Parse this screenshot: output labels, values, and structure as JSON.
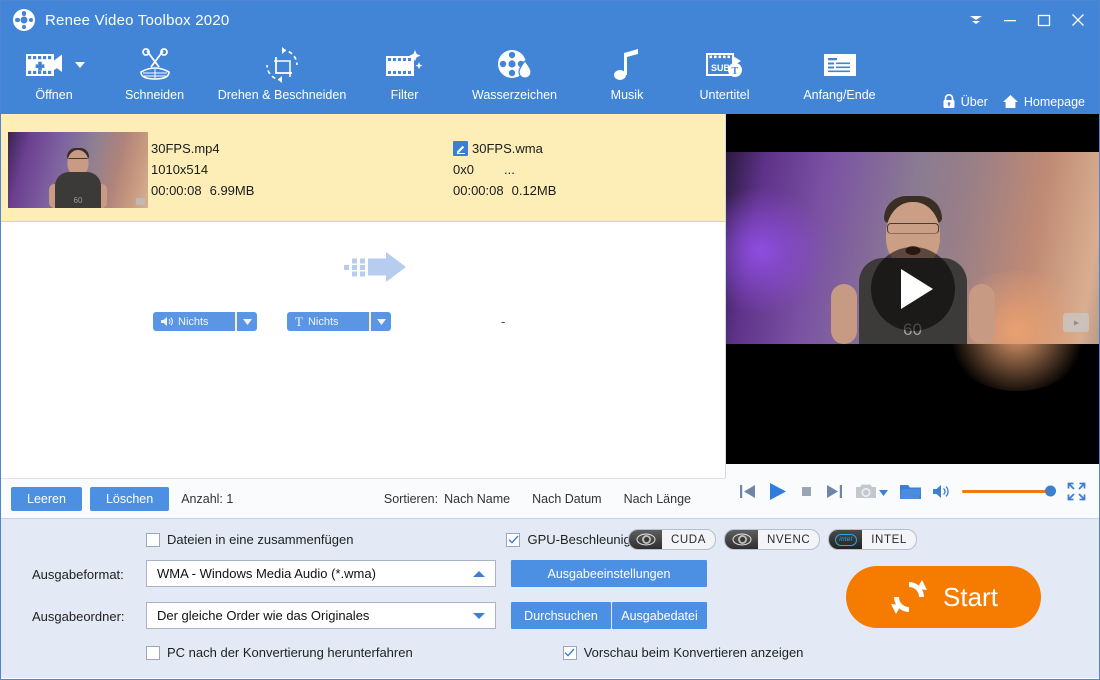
{
  "window": {
    "title": "Renee Video Toolbox 2020",
    "logo_icon": "film-reel-icon",
    "controls": [
      {
        "name": "collapse-ribbon-button",
        "icon": "chevron-double-down-icon"
      },
      {
        "name": "minimize-button",
        "icon": "minimize-icon"
      },
      {
        "name": "maximize-button",
        "icon": "maximize-icon"
      },
      {
        "name": "close-button",
        "icon": "close-icon"
      }
    ]
  },
  "toolbar": {
    "items": [
      {
        "label": "Öffnen",
        "icon": "add-film-icon",
        "has_dropdown": true
      },
      {
        "label": "Schneiden",
        "icon": "scissors-icon",
        "has_dropdown": false
      },
      {
        "label": "Drehen & Beschneiden",
        "icon": "rotate-crop-icon",
        "has_dropdown": false
      },
      {
        "label": "Filter",
        "icon": "film-sparkle-icon",
        "has_dropdown": false
      },
      {
        "label": "Wasserzeichen",
        "icon": "film-reel-drop-icon",
        "has_dropdown": false
      },
      {
        "label": "Musik",
        "icon": "music-note-icon",
        "has_dropdown": false
      },
      {
        "label": "Untertitel",
        "icon": "subtitle-sub-t-icon",
        "has_dropdown": false
      },
      {
        "label": "Anfang/Ende",
        "icon": "intro-outro-icon",
        "has_dropdown": false
      }
    ],
    "right_links": [
      {
        "label": "Über",
        "icon": "lock-icon"
      },
      {
        "label": "Homepage",
        "icon": "home-icon"
      }
    ]
  },
  "file_row": {
    "thumbnail_name": "video-thumbnail",
    "source": {
      "filename": "30FPS.mp4",
      "resolution": "1010x514",
      "duration": "00:00:08",
      "size": "6.99MB"
    },
    "convert_arrow_icon": "pixel-arrow-right-icon",
    "target": {
      "edit_icon": "pencil-edit-icon",
      "filename": "30FPS.wma",
      "resolution": "0x0",
      "extra": "...",
      "duration": "00:00:08",
      "size": "0.12MB"
    },
    "audio_track": {
      "icon": "speaker-icon",
      "label": "Nichts",
      "dropdown_icon": "chevron-down-icon"
    },
    "subtitle_track": {
      "icon": "text-t-icon",
      "label": "Nichts",
      "dropdown_icon": "chevron-down-icon"
    },
    "status": "-"
  },
  "list_bar": {
    "clear_label": "Leeren",
    "delete_label": "Löschen",
    "count_label": "Anzahl: 1",
    "sort_label": "Sortieren:",
    "sort_options": [
      "Nach Name",
      "Nach Datum",
      "Nach Länge"
    ]
  },
  "preview": {
    "play_overlay_icon": "play-circle-icon",
    "watermark_icon": "tv-logo-icon",
    "shirt_text": "60",
    "controls": [
      {
        "name": "previous-button",
        "icon": "skip-previous-icon"
      },
      {
        "name": "play-button",
        "icon": "play-icon"
      },
      {
        "name": "stop-button",
        "icon": "stop-icon"
      },
      {
        "name": "next-button",
        "icon": "skip-next-icon"
      },
      {
        "name": "snapshot-button",
        "icon": "camera-icon"
      },
      {
        "name": "snapshot-dropdown",
        "icon": "chevron-down-icon"
      },
      {
        "name": "open-folder-button",
        "icon": "folder-icon"
      },
      {
        "name": "volume-button",
        "icon": "speaker-icon"
      },
      {
        "name": "volume-slider",
        "icon": "slider-icon"
      },
      {
        "name": "fullscreen-button",
        "icon": "fullscreen-icon"
      }
    ],
    "volume_percent": 100
  },
  "settings": {
    "merge_checkbox": {
      "label": "Dateien in eine zusammenfügen",
      "checked": false
    },
    "gpu_checkbox": {
      "label": "GPU-Beschleunigung",
      "checked": true
    },
    "gpu_badges": [
      {
        "label": "CUDA",
        "icon": "nvidia-eye-icon"
      },
      {
        "label": "NVENC",
        "icon": "nvidia-eye-icon"
      },
      {
        "label": "INTEL",
        "icon": "intel-logo-icon"
      }
    ],
    "output_format_label": "Ausgabeformat:",
    "output_format_value": "WMA - Windows Media Audio (*.wma)",
    "output_format_arrow_icon": "chevron-up-icon",
    "output_settings_button": "Ausgabeeinstellungen",
    "output_folder_label": "Ausgabeordner:",
    "output_folder_value": "Der gleiche Order wie das Originales",
    "output_folder_arrow_icon": "chevron-down-icon",
    "browse_button": "Durchsuchen",
    "output_file_button": "Ausgabedatei",
    "shutdown_checkbox": {
      "label": "PC nach der Konvertierung herunterfahren",
      "checked": false
    },
    "preview_checkbox": {
      "label": "Vorschau beim Konvertieren anzeigen",
      "checked": true
    },
    "start_button": {
      "label": "Start",
      "icon": "refresh-cycle-icon"
    }
  },
  "colors": {
    "header_blue": "#4285d6",
    "accent_blue": "#4b90e2",
    "row_yellow": "#fdeeb8",
    "panel_blue": "#e4eaf5",
    "start_orange": "#f57c00"
  }
}
